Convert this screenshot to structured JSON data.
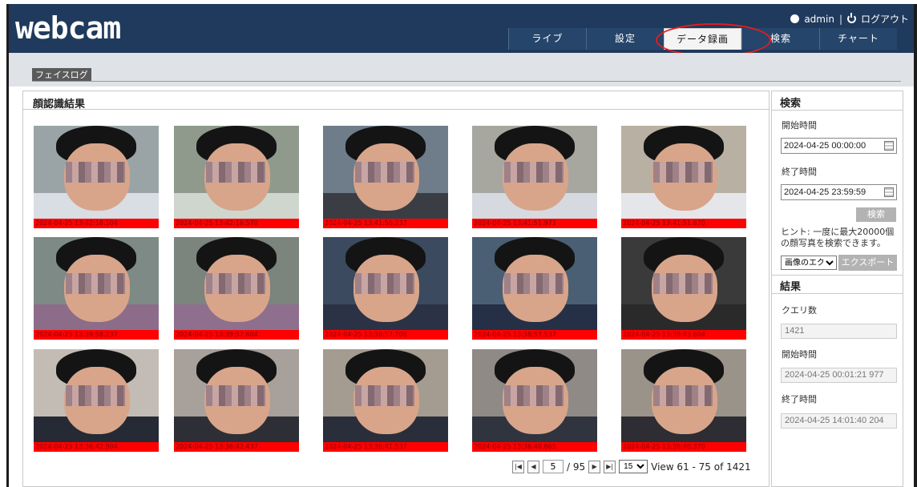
{
  "app": {
    "logo": "webcam"
  },
  "userbar": {
    "user": "admin",
    "separator": "|",
    "logout": "ログアウト"
  },
  "tabs": [
    {
      "label": "ライブ"
    },
    {
      "label": "設定"
    },
    {
      "label": "データ録画",
      "active": true
    },
    {
      "label": "検索"
    },
    {
      "label": "チャート"
    }
  ],
  "breadcrumb": "フェイスログ",
  "main": {
    "title": "顔認識結果",
    "results": [
      {
        "timestamp": "2024-04-25 13:42:18.104"
      },
      {
        "timestamp": "2024-04-25 13:42:16.570"
      },
      {
        "timestamp": "2024-04-25 13:41:50.237"
      },
      {
        "timestamp": "2024-04-25 13:41:51.971"
      },
      {
        "timestamp": "2024-04-25 13:41:51.670"
      },
      {
        "timestamp": "2024-04-25 13:39:58.237"
      },
      {
        "timestamp": "2024-04-25 13:39:57.604"
      },
      {
        "timestamp": "2024-04-25 13:38:57.706"
      },
      {
        "timestamp": "2024-04-25 13:38:57.537"
      },
      {
        "timestamp": "2024-04-25 13:38:43.604"
      },
      {
        "timestamp": "2024-04-25 13:36:42.904"
      },
      {
        "timestamp": "2024-04-25 13:36:42.437"
      },
      {
        "timestamp": "2024-04-25 13:36:41.537"
      },
      {
        "timestamp": "2024-04-25 13:36:40.865"
      },
      {
        "timestamp": "2024-04-25 13:36:40.370"
      }
    ]
  },
  "pager": {
    "page": "5",
    "total_pages": "/ 95",
    "per_page": "15",
    "summary": "View 61 - 75 of 1421"
  },
  "search": {
    "title": "検索",
    "start_label": "開始時間",
    "start_value": "2024-04-25 00:00:00",
    "end_label": "終了時間",
    "end_value": "2024-04-25 23:59:59",
    "button": "検索",
    "hint": "ヒント: 一度に最大20000個の顔写真を検索できます。",
    "export_select": "画像のエクス",
    "export_button": "エクスポート"
  },
  "result": {
    "title": "結果",
    "count_label": "クエリ数",
    "count_value": "1421",
    "start_label": "開始時間",
    "start_value": "2024-04-25 00:01:21 977",
    "end_label": "終了時間",
    "end_value": "2024-04-25 14:01:40 204"
  },
  "colors": {
    "header": "#1f3a5c",
    "timestamp_bar": "#ff0000",
    "highlight": "#e41d1d"
  }
}
